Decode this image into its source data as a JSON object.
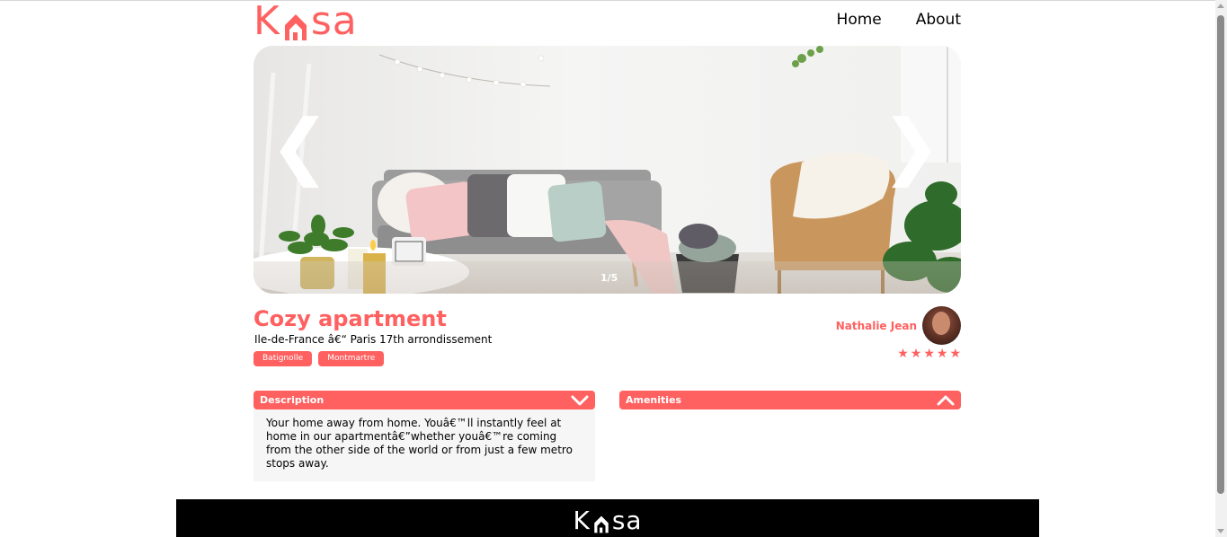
{
  "brand": {
    "logo_left": "K",
    "logo_right": "sa",
    "accent_color": "#ff6060"
  },
  "nav": {
    "home_label": "Home",
    "about_label": "About"
  },
  "carousel": {
    "prev_icon": "chevron-left-icon",
    "next_icon": "chevron-right-icon",
    "prev_glyph": "❮",
    "next_glyph": "❯",
    "counter": "1/5"
  },
  "listing": {
    "title": "Cozy apartment",
    "location": "Ile-de-France â€“ Paris 17th arrondissement",
    "tags": [
      "Batignolle",
      "Montmartre"
    ]
  },
  "host": {
    "name": "Nathalie Jean",
    "rating": 5,
    "rating_max": 5
  },
  "sections": {
    "description": {
      "label": "Description",
      "text": "Your home away from home. Youâ€™ll instantly feel at home in our apartmentâ€”whether youâ€™re coming from the other side of the world or from just a few metro stops away."
    },
    "amenities": {
      "label": "Amenities"
    }
  },
  "footer": {
    "logo_left": "K",
    "logo_right": "sa"
  }
}
